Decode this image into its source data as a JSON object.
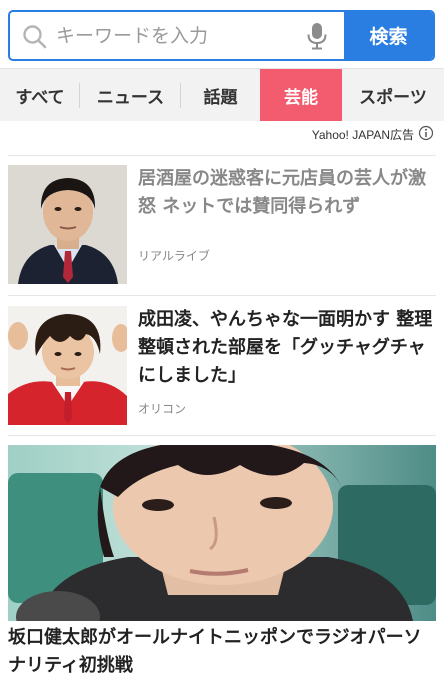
{
  "search": {
    "placeholder": "キーワードを入力",
    "button_label": "検索"
  },
  "tabs": [
    {
      "label": "すべて",
      "active": false
    },
    {
      "label": "ニュース",
      "active": false
    },
    {
      "label": "話題",
      "active": false
    },
    {
      "label": "芸能",
      "active": true
    },
    {
      "label": "スポーツ",
      "active": false
    }
  ],
  "ad": {
    "label": "Yahoo! JAPAN広告"
  },
  "articles": [
    {
      "title": "居酒屋の迷惑客に元店員の芸人が激怒 ネットでは賛同得られず",
      "source": "リアルライブ",
      "read": true
    },
    {
      "title": "成田凌、やんちゃな一面明かす 整理整頓された部屋を「グッチャグチャにしました」",
      "source": "オリコン",
      "read": false
    }
  ],
  "featured": {
    "title": "坂口健太郎がオールナイトニッポンでラジオパーソナリティ初挑戦"
  },
  "colors": {
    "accent": "#2a7de1",
    "active_tab": "#f25c6e"
  }
}
